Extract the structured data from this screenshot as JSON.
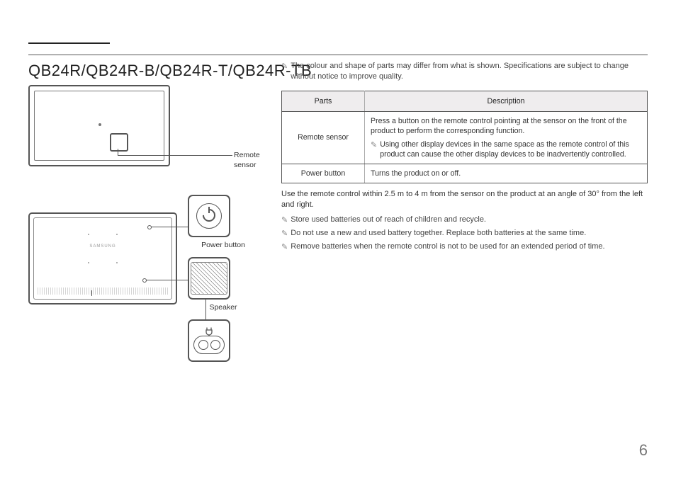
{
  "title": "QB24R/QB24R-B/QB24R-T/QB24R-TB",
  "labels": {
    "remote_sensor": "Remote sensor",
    "power_button": "Power button",
    "speaker": "Speaker",
    "rear_logo": "SAMSUNG"
  },
  "intro_note": "The colour and shape of parts may differ from what is shown. Specifications are subject to change without notice to improve quality.",
  "table": {
    "head_parts": "Parts",
    "head_desc": "Description",
    "rows": [
      {
        "part": "Remote sensor",
        "desc": "Press a button on the remote control pointing at the sensor on the front of the product to perform the corresponding function.",
        "note": "Using other display devices in the same space as the remote control of this product can cause the other display devices to be inadvertently controlled."
      },
      {
        "part": "Power button",
        "desc": "Turns the product on or off."
      }
    ]
  },
  "usage": "Use the remote control within 2.5 m to 4 m from the sensor on the product at an angle of 30° from the left and right.",
  "bullets": [
    "Store used batteries out of reach of children and recycle.",
    "Do not use a new and used battery together. Replace both batteries at the same time.",
    "Remove batteries when the remote control is not to be used for an extended period of time."
  ],
  "page_number": "6"
}
